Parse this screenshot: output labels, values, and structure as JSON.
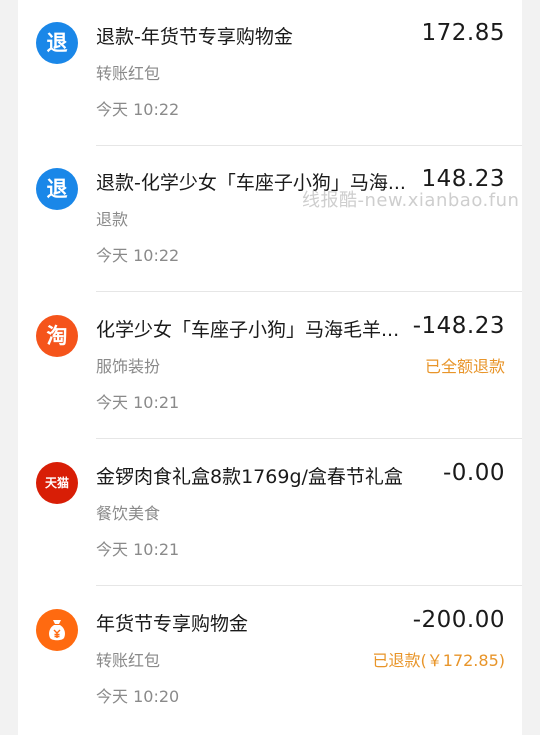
{
  "transactions": [
    {
      "icon": "refund",
      "icon_text": "退",
      "title": "退款-年货节专享购物金",
      "amount": "172.85",
      "category": "转账红包",
      "time": "今天 10:22",
      "status": ""
    },
    {
      "icon": "refund",
      "icon_text": "退",
      "title": "退款-化学少女「车座子小狗」马海...",
      "amount": "148.23",
      "category": "退款",
      "time": "今天 10:22",
      "status": ""
    },
    {
      "icon": "taobao",
      "icon_text": "淘",
      "title": "化学少女「车座子小狗」马海毛羊...",
      "amount": "-148.23",
      "category": "服饰装扮",
      "time": "今天 10:21",
      "status": "已全额退款"
    },
    {
      "icon": "tmall",
      "icon_text": "天猫",
      "title": "金锣肉食礼盒8款1769g/盒春节礼盒 ...",
      "amount": "-0.00",
      "category": "餐饮美食",
      "time": "今天 10:21",
      "status": ""
    },
    {
      "icon": "gold",
      "icon_text": "",
      "title": "年货节专享购物金",
      "amount": "-200.00",
      "category": "转账红包",
      "time": "今天 10:20",
      "status": "已退款(￥172.85)"
    }
  ],
  "watermark": "线报酷-new.xianbao.fun",
  "colors": {
    "refund_icon": "#1a87e8",
    "taobao_icon": "#f5541b",
    "tmall_icon": "#d81e06",
    "gold_icon": "#ff6a10",
    "status_text": "#e8952a"
  }
}
